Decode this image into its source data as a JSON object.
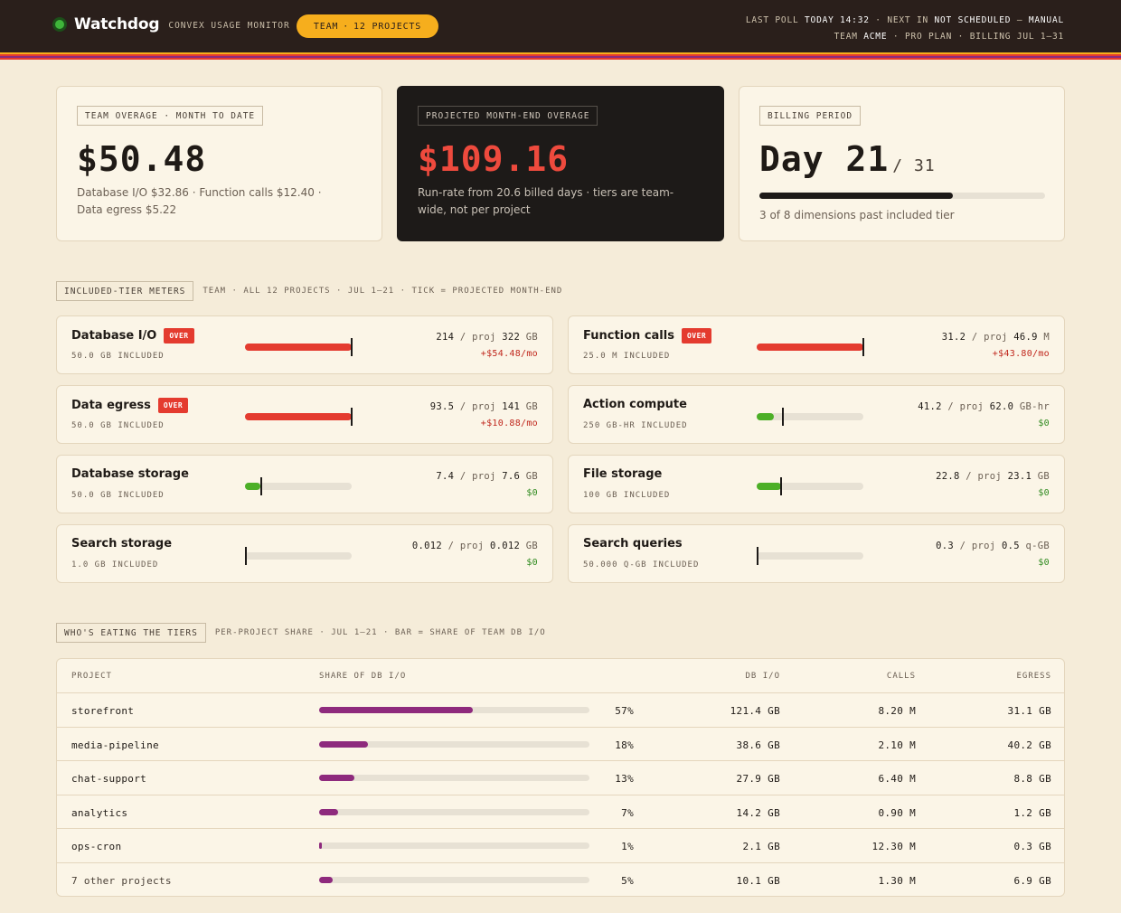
{
  "header": {
    "app_name": "Watchdog",
    "app_subtitle": "CONVEX USAGE MONITOR",
    "team_pill": {
      "label": "TEAM",
      "sep": "·",
      "projects": "12 PROJECTS"
    },
    "poll_line1": {
      "last_poll_label": "LAST POLL",
      "last_poll_value": "TODAY 14:32",
      "sep": "·",
      "next_label": "NEXT IN",
      "next_value": "NOT SCHEDULED",
      "dash": "—",
      "mode": "MANUAL"
    },
    "poll_line2": {
      "team_label": "TEAM",
      "team_value": "ACME",
      "sep": "·",
      "plan": "PRO PLAN",
      "billing": "BILLING JUL 1–31"
    },
    "stripe_colors": [
      "#f6ae1d",
      "#e43b2f",
      "#8e2a7d",
      "#e43b2f"
    ]
  },
  "summary": {
    "overage": {
      "tag": "TEAM OVERAGE  ·  MONTH TO DATE",
      "value": "$50.48",
      "detail": "Database I/O $32.86 · Function calls $12.40 · Data egress $5.22"
    },
    "projected": {
      "tag": "PROJECTED MONTH-END OVERAGE",
      "value": "$109.16",
      "detail": "Run-rate from 20.6 billed days · tiers are team-wide, not per project"
    },
    "billing": {
      "tag": "BILLING PERIOD",
      "day_label": "Day 21",
      "of_label": "/ 31",
      "progress_fraction": 0.677,
      "detail": "3 of 8 dimensions past included tier"
    }
  },
  "meters_section": {
    "tag": "INCLUDED-TIER METERS",
    "meta": "TEAM  ·  ALL 12 PROJECTS  ·  JUL 1–21  ·  TICK = PROJECTED MONTH-END"
  },
  "meters": [
    {
      "name": "Database I/O",
      "over": true,
      "over_label": "OVER",
      "included": "50.0 GB INCLUDED",
      "current": "214",
      "slash": "/",
      "proj_label": "proj",
      "projected": "322",
      "unit": "GB",
      "cost": "+$54.48/mo",
      "fill_fraction": 1.0,
      "tick_fraction": 1.0
    },
    {
      "name": "Function calls",
      "over": true,
      "over_label": "OVER",
      "included": "25.0 M INCLUDED",
      "current": "31.2",
      "slash": "/",
      "proj_label": "proj",
      "projected": "46.9",
      "unit": "M",
      "cost": "+$43.80/mo",
      "fill_fraction": 1.0,
      "tick_fraction": 1.0
    },
    {
      "name": "Data egress",
      "over": true,
      "over_label": "OVER",
      "included": "50.0 GB INCLUDED",
      "current": "93.5",
      "slash": "/",
      "proj_label": "proj",
      "projected": "141",
      "unit": "GB",
      "cost": "+$10.88/mo",
      "fill_fraction": 1.0,
      "tick_fraction": 1.0
    },
    {
      "name": "Action compute",
      "over": false,
      "over_label": "",
      "included": "250 GB-HR INCLUDED",
      "current": "41.2",
      "slash": "/",
      "proj_label": "proj",
      "projected": "62.0",
      "unit": "GB-hr",
      "cost": "$0",
      "fill_fraction": 0.165,
      "tick_fraction": 0.248
    },
    {
      "name": "Database storage",
      "over": false,
      "over_label": "",
      "included": "50.0 GB INCLUDED",
      "current": "7.4",
      "slash": "/",
      "proj_label": "proj",
      "projected": "7.6",
      "unit": "GB",
      "cost": "$0",
      "fill_fraction": 0.148,
      "tick_fraction": 0.152
    },
    {
      "name": "File storage",
      "over": false,
      "over_label": "",
      "included": "100 GB INCLUDED",
      "current": "22.8",
      "slash": "/",
      "proj_label": "proj",
      "projected": "23.1",
      "unit": "GB",
      "cost": "$0",
      "fill_fraction": 0.228,
      "tick_fraction": 0.231
    },
    {
      "name": "Search storage",
      "over": false,
      "over_label": "",
      "included": "1.0 GB INCLUDED",
      "current": "0.012",
      "slash": "/",
      "proj_label": "proj",
      "projected": "0.012",
      "unit": "GB",
      "cost": "$0",
      "fill_fraction": 0.012,
      "tick_fraction": 0.012
    },
    {
      "name": "Search queries",
      "over": false,
      "over_label": "",
      "included": "50.000 Q-GB INCLUDED",
      "current": "0.3",
      "slash": "/",
      "proj_label": "proj",
      "projected": "0.5",
      "unit": "q-GB",
      "cost": "$0",
      "fill_fraction": 0.006,
      "tick_fraction": 0.01
    }
  ],
  "colors": {
    "over": "#e43b2f",
    "ok": "#4caf27",
    "cost_over": "#c0271d",
    "cost_ok": "#2e8a1e",
    "share": "#8e2a7d"
  },
  "share_section": {
    "tag": "WHO'S EATING THE TIERS",
    "meta": "PER-PROJECT SHARE  ·  JUL 1–21  ·  BAR = SHARE OF TEAM DB I/O"
  },
  "table": {
    "headers": {
      "project": "PROJECT",
      "share": "SHARE OF DB I/O",
      "db_io": "DB I/O",
      "calls": "CALLS",
      "egress": "EGRESS"
    },
    "rows": [
      {
        "project": "storefront",
        "share": 0.57,
        "share_label": "57%",
        "db_io": "121.4 GB",
        "calls": "8.20 M",
        "egress": "31.1 GB"
      },
      {
        "project": "media-pipeline",
        "share": 0.18,
        "share_label": "18%",
        "db_io": "38.6 GB",
        "calls": "2.10 M",
        "egress": "40.2 GB"
      },
      {
        "project": "chat-support",
        "share": 0.13,
        "share_label": "13%",
        "db_io": "27.9 GB",
        "calls": "6.40 M",
        "egress": "8.8 GB"
      },
      {
        "project": "analytics",
        "share": 0.07,
        "share_label": "7%",
        "db_io": "14.2 GB",
        "calls": "0.90 M",
        "egress": "1.2 GB"
      },
      {
        "project": "ops-cron",
        "share": 0.01,
        "share_label": "1%",
        "db_io": "2.1 GB",
        "calls": "12.30 M",
        "egress": "0.3 GB"
      },
      {
        "project": "7 other projects",
        "share": 0.05,
        "share_label": "5%",
        "db_io": "10.1 GB",
        "calls": "1.30 M",
        "egress": "6.9 GB"
      }
    ]
  }
}
